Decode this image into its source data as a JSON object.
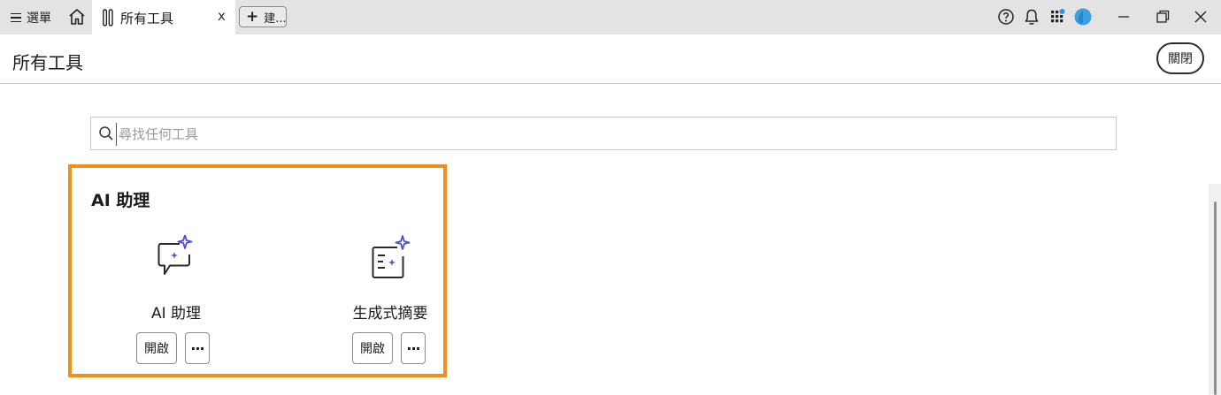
{
  "titlebar": {
    "menu_label": "選單",
    "tab_label": "所有工具",
    "tab_close": "x",
    "new_tab_label": "建...",
    "new_tab_plus": "+"
  },
  "header": {
    "title": "所有工具",
    "close_label": "關閉"
  },
  "search": {
    "placeholder": "尋找任何工具"
  },
  "section": {
    "title": "AI 助理",
    "tools": [
      {
        "label": "AI 助理",
        "open_label": "開啟",
        "more_label": "···",
        "icon": "ai-assistant-chat-sparkle-icon"
      },
      {
        "label": "生成式摘要",
        "open_label": "開啟",
        "more_label": "···",
        "icon": "generative-summary-doc-sparkle-icon"
      }
    ]
  },
  "colors": {
    "highlight": "#f0901a",
    "sparkle": "#4b4fc9",
    "avatar": "#3aa0e0"
  }
}
